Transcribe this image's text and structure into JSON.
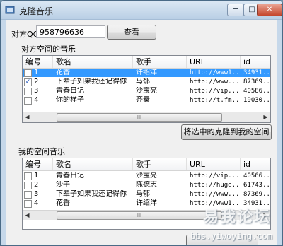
{
  "window": {
    "title": "克隆音乐",
    "min": "─",
    "max": "□",
    "close": "✕"
  },
  "top": {
    "qq_label": "对方QQ:",
    "qq_value": "958796636",
    "view_button": "查看"
  },
  "group1": {
    "title": "对方空间的音乐",
    "columns": [
      "编号",
      "歌名",
      "歌手",
      "URL",
      "id"
    ],
    "rows": [
      {
        "checked": false,
        "no": "1",
        "name": "花香",
        "singer": "许绍洋",
        "url": "http://www1...",
        "id": "34931...",
        "selected": true
      },
      {
        "checked": true,
        "no": "2",
        "name": "下辈子如果我还记得你",
        "singer": "马郁",
        "url": "http://www....",
        "id": "87369...",
        "selected": false
      },
      {
        "checked": false,
        "no": "3",
        "name": "青春日记",
        "singer": "沙宝亮",
        "url": "http://vip....",
        "id": "40586...",
        "selected": false
      },
      {
        "checked": false,
        "no": "4",
        "name": "你的样子",
        "singer": "齐秦",
        "url": "http://t.fm...",
        "id": "19030...",
        "selected": false
      }
    ],
    "scroll_left": "◀",
    "scroll_right": "▶",
    "scroll_thumb": "III"
  },
  "clone_button": "将选中的克隆到我的空间",
  "group2": {
    "title": "我的空间音乐",
    "columns": [
      "编号",
      "歌名",
      "歌手",
      "URL",
      "id"
    ],
    "rows": [
      {
        "checked": false,
        "no": "1",
        "name": "青春日记",
        "singer": "沙宝亮",
        "url": "http://vip....",
        "id": "40566..."
      },
      {
        "checked": false,
        "no": "2",
        "name": "沙子",
        "singer": "陈德志",
        "url": "http://huge...",
        "id": "61743..."
      },
      {
        "checked": false,
        "no": "3",
        "name": "下辈子如果我还记得你",
        "singer": "马郁",
        "url": "http://www....",
        "id": "87369..."
      },
      {
        "checked": false,
        "no": "4",
        "name": "花香",
        "singer": "许绍洋",
        "url": "http://www1...",
        "id": "34931..."
      }
    ],
    "scroll_left": "◀",
    "scroll_right": "▶",
    "scroll_thumb": "III"
  },
  "watermark": {
    "main": "易我论坛",
    "sub": "bbs.yiwoying.com"
  }
}
